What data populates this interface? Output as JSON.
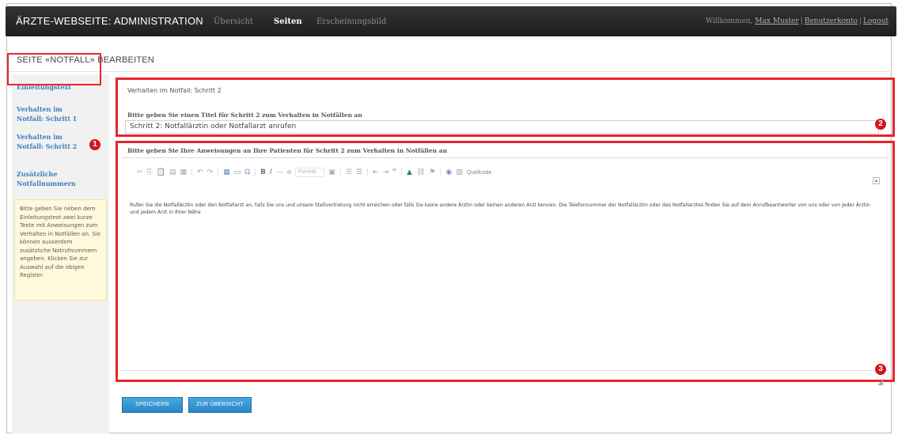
{
  "header": {
    "app_title": "ÄRZTE-WEBSEITE: ADMINISTRATION",
    "nav": [
      "Übersicht",
      "Seiten",
      "Erscheinungsbild"
    ],
    "active_nav": "Seiten",
    "welcome": "Willkommen,",
    "user_name": "Max Muster",
    "account_link": "Benutzerkonto",
    "logout_link": "Logout"
  },
  "page": {
    "title": "SEITE «NOTFALL» BEARBEITEN"
  },
  "sidebar": {
    "items": [
      {
        "label": "Einleitungstext"
      },
      {
        "label": "Verhalten im Notfall: Schritt 1"
      },
      {
        "label": "Verhalten im Notfall: Schritt 2"
      },
      {
        "label": "Zusätzliche Notfallnummern"
      }
    ],
    "active_index": 2,
    "help_text": "Bitte geben Sie neben dem Einleitungstext zwei kurze Texte mit Anweisungen zum Verhalten in Notfällen an. Sie können ausserdem zusätzliche Notrufnummern angeben. Klicken Sie zur Auswahl auf die obigen Register."
  },
  "markers": [
    "1",
    "2",
    "3"
  ],
  "form": {
    "section_heading": "Verhalten im Notfall: Schritt 2",
    "title_label": "Bitte geben Sie einen Titel für Schritt 2 zum Verhalten in Notfällen an",
    "title_value": "Schritt 2: Notfallärztin oder Notfallarzt anrufen",
    "editor_label": "Bitte geben Sie Ihre Anweisungen an Ihre Patienten für Schritt 2 zum Verhalten in Notfällen an",
    "toolbar": {
      "format_placeholder": "Format",
      "source_label": "Quellcode"
    },
    "editor_content": "Rufen Sie die Notfallärztin oder den Notfallarzt an, falls Sie uns und unsere Stellvertretung nicht erreichen oder falls Sie keine andere Ärztin oder keinen anderen Arzt kennen. Die Telefonnummer der Notfallärztin oder des Notfallarztes finden Sie auf dem Anrufbeantworter von uns oder von jeder Ärztin und jedem Arzt in Ihrer Nähe"
  },
  "buttons": {
    "save": "SPEICHERN",
    "overview": "ZUR ÜBERSICHT"
  }
}
